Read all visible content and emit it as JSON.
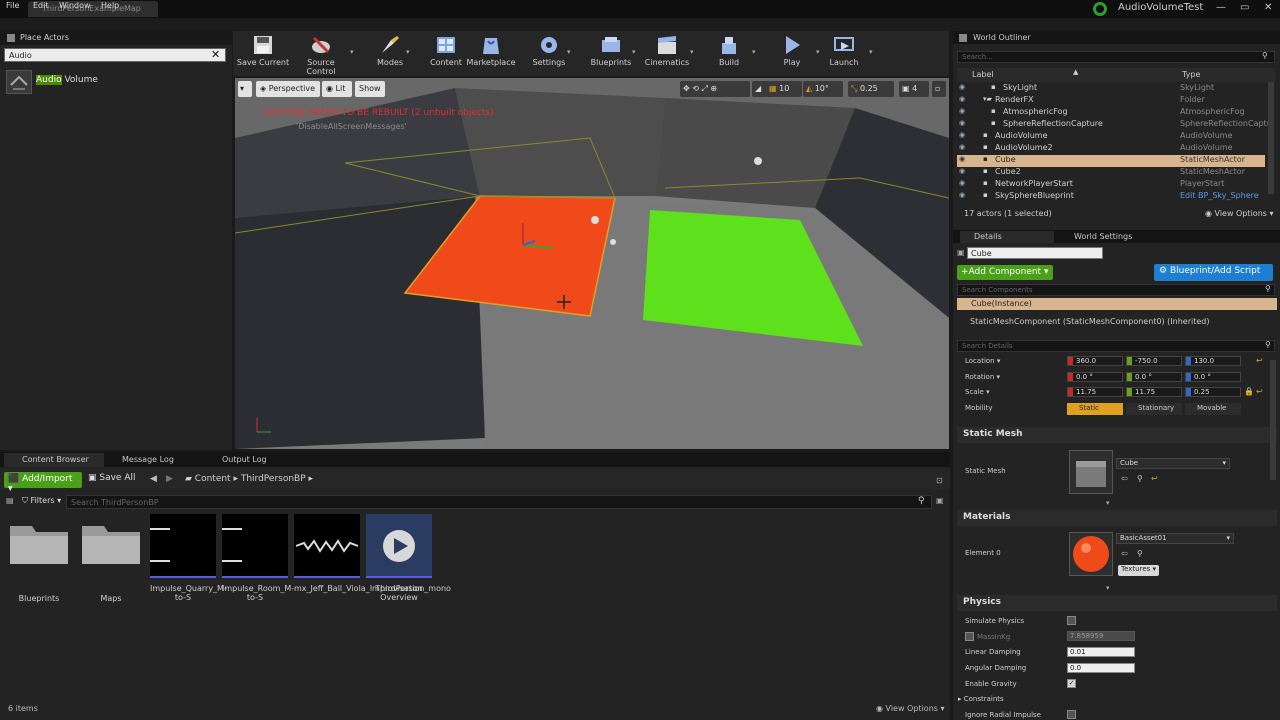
{
  "window": {
    "map_tab": "ThirdPersonExampleMap",
    "project_title": "AudioVolumeTest"
  },
  "menu": [
    "File",
    "Edit",
    "Window",
    "Help"
  ],
  "place_actors": {
    "header": "Place Actors",
    "search_value": "Audio",
    "results": [
      {
        "highlight": "Audio",
        "rest": " Volume"
      }
    ]
  },
  "toolbar": {
    "buttons": [
      "Save Current",
      "Source Control",
      "Modes",
      "Content",
      "Marketplace",
      "Settings",
      "Blueprints",
      "Cinematics",
      "Build",
      "Play",
      "Launch"
    ]
  },
  "viewport": {
    "perspective": "Perspective",
    "lit": "Lit",
    "show": "Show",
    "warning": "LIGHTING NEEDS TO BE REBUILT (2 unbuilt objects)",
    "disable_msg": "'DisableAllScreenMessages'",
    "grid_snap": "10",
    "rot_snap": "10°",
    "scale_snap": "0.25",
    "cam_speed": "4"
  },
  "content_browser": {
    "tabs": [
      "Content Browser",
      "Message Log",
      "Output Log"
    ],
    "add_import": "Add/Import",
    "save_all": "Save All",
    "crumbs": [
      "Content",
      "ThirdPersonBP"
    ],
    "filters": "Filters",
    "search_placeholder": "Search ThirdPersonBP",
    "assets": [
      {
        "name": "Blueprints",
        "kind": "folder"
      },
      {
        "name": "Maps",
        "kind": "folder"
      },
      {
        "name": "Impulse_Quarry_M-to-S",
        "kind": "sound"
      },
      {
        "name": "Impulse_Room_M-to-S",
        "kind": "sound"
      },
      {
        "name": "mx_Jeff_Ball_Viola_Improvisation_mono",
        "kind": "wave"
      },
      {
        "name": "ThirdPerson Overview",
        "kind": "tutorial"
      }
    ],
    "item_count": "6 items",
    "view_options": "View Options"
  },
  "world_outliner": {
    "header": "World Outliner",
    "search_placeholder": "Search...",
    "col_label": "Label",
    "col_type": "Type",
    "rows": [
      {
        "label": "SkyLight",
        "type": "SkyLight",
        "indent": 2,
        "selected": false
      },
      {
        "label": "RenderFX",
        "type": "Folder",
        "indent": 1,
        "selected": false
      },
      {
        "label": "AtmosphericFog",
        "type": "AtmosphericFog",
        "indent": 2,
        "selected": false
      },
      {
        "label": "SphereReflectionCapture",
        "type": "SphereReflectionCaptu",
        "indent": 2,
        "selected": false
      },
      {
        "label": "AudioVolume",
        "type": "AudioVolume",
        "indent": 1,
        "selected": false
      },
      {
        "label": "AudioVolume2",
        "type": "AudioVolume",
        "indent": 1,
        "selected": false
      },
      {
        "label": "Cube",
        "type": "StaticMeshActor",
        "indent": 1,
        "selected": true
      },
      {
        "label": "Cube2",
        "type": "StaticMeshActor",
        "indent": 1,
        "selected": false
      },
      {
        "label": "NetworkPlayerStart",
        "type": "PlayerStart",
        "indent": 1,
        "selected": false
      },
      {
        "label": "SkySphereBlueprint",
        "type": "Edit BP_Sky_Sphere",
        "indent": 1,
        "selected": false
      }
    ],
    "actor_count": "17 actors (1 selected)",
    "view_options": "View Options"
  },
  "details": {
    "tab_details": "Details",
    "tab_world": "World Settings",
    "name_value": "Cube",
    "add_component": "Add Component",
    "blueprint_script": "Blueprint/Add Script",
    "search_components": "Search Components",
    "instance": "Cube(Instance)",
    "component": "StaticMeshComponent (StaticMeshComponent0) (Inherited)",
    "search_details": "Search Details",
    "location_label": "Location",
    "location": [
      "360.0",
      "-750.0",
      "130.0"
    ],
    "rotation_label": "Rotation",
    "rotation": [
      "0.0 °",
      "0.0 °",
      "0.0 °"
    ],
    "scale_label": "Scale",
    "scale": [
      "11.75",
      "11.75",
      "0.25"
    ],
    "mobility_label": "Mobility",
    "mobility": [
      "Static",
      "Stationary",
      "Movable"
    ],
    "static_mesh_section": "Static Mesh",
    "static_mesh_label": "Static Mesh",
    "static_mesh_value": "Cube",
    "materials_section": "Materials",
    "element0_label": "Element 0",
    "element0_value": "BasicAsset01",
    "textures": "Textures",
    "physics_section": "Physics",
    "simulate_physics": "Simulate Physics",
    "mass_label": "MassInKg",
    "mass_value": "7.858959",
    "linear_damping_label": "Linear Damping",
    "linear_damping": "0.01",
    "angular_damping_label": "Angular Damping",
    "angular_damping": "0.0",
    "enable_gravity": "Enable Gravity",
    "constraints": "Constraints",
    "ignore_radial": "Ignore Radial Impulse"
  },
  "colors": {
    "accent_green": "#4aa019",
    "blueprint_blue": "#1d7fd3",
    "selection": "#d8b58f",
    "cube_orange": "#f04a1a",
    "cube_green": "#5ee01c"
  }
}
